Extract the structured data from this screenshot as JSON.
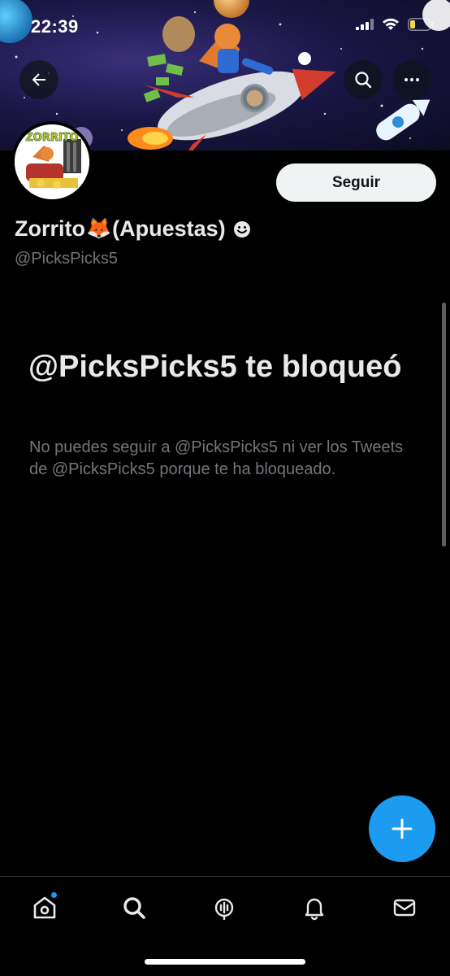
{
  "status_bar": {
    "time": "22:39"
  },
  "profile": {
    "avatar_text": "ZORRITO",
    "name": "Zorrito",
    "name_emoji": "🦊",
    "name_suffix": "(Apuestas)",
    "handle": "@PicksPicks5",
    "follow_label": "Seguir"
  },
  "blocked": {
    "title": "@PicksPicks5 te bloqueó",
    "description": "No puedes seguir a @PicksPicks5 ni ver los Tweets de @PicksPicks5 porque te ha bloqueado."
  },
  "icons": {
    "back": "arrow-left-icon",
    "search": "search-icon",
    "more": "more-horizontal-icon",
    "compose": "plus-icon",
    "home": "home-icon",
    "explore": "search-icon",
    "spaces": "microphone-icon",
    "notifications": "bell-icon",
    "messages": "envelope-icon"
  },
  "colors": {
    "accent": "#1d9bf0",
    "background": "#000000",
    "text_primary": "#e7e9ea",
    "text_secondary": "#71767b",
    "follow_button_bg": "#eff3f4",
    "battery_fill": "#f7d34a"
  }
}
